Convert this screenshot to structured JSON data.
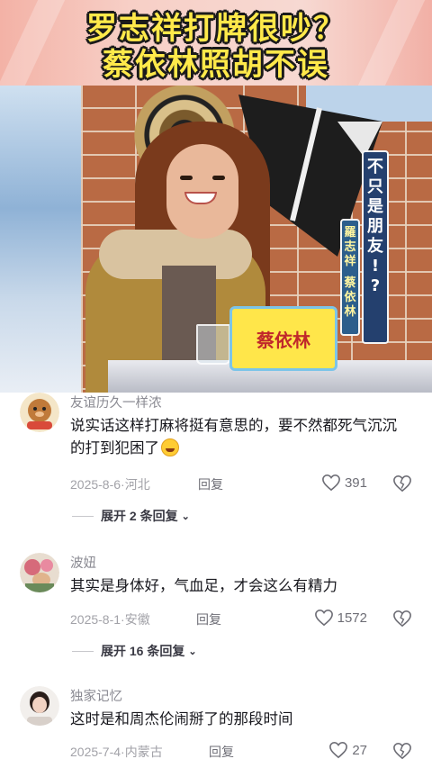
{
  "video": {
    "headline_line1": "罗志祥打牌很吵？",
    "headline_line2": "蔡依林照胡不误",
    "nameplate": "蔡依林",
    "caption_vertical": [
      "不",
      "只",
      "是",
      "朋",
      "友",
      "!",
      "?"
    ],
    "caption_names": [
      "羅",
      "志",
      "祥",
      "",
      "蔡",
      "依",
      "林"
    ]
  },
  "comments": [
    {
      "username": "友谊历久一样浓",
      "text": "说实话这样打麻将挺有意思的，要不然都死气沉沉的打到犯困了",
      "emoji": "crying-laughing-emoji",
      "date": "2025-8-6",
      "location": "河北",
      "reply_label": "回复",
      "likes": "391",
      "expand_label": "展开 2 条回复"
    },
    {
      "username": "波妞",
      "text": "其实是身体好，气血足，才会这么有精力",
      "date": "2025-8-1",
      "location": "安徽",
      "reply_label": "回复",
      "likes": "1572",
      "expand_label": "展开 16 条回复"
    },
    {
      "username": "独家记忆",
      "text": "这时是和周杰伦闹掰了的那段时间",
      "date": "2025-7-4",
      "location": "内蒙古",
      "reply_label": "回复",
      "likes": "27"
    }
  ],
  "colors": {
    "headline_fill": "#ffe94a",
    "caption_bg": "#24406e",
    "text_primary": "#18181e",
    "text_secondary": "#8a8a92"
  }
}
